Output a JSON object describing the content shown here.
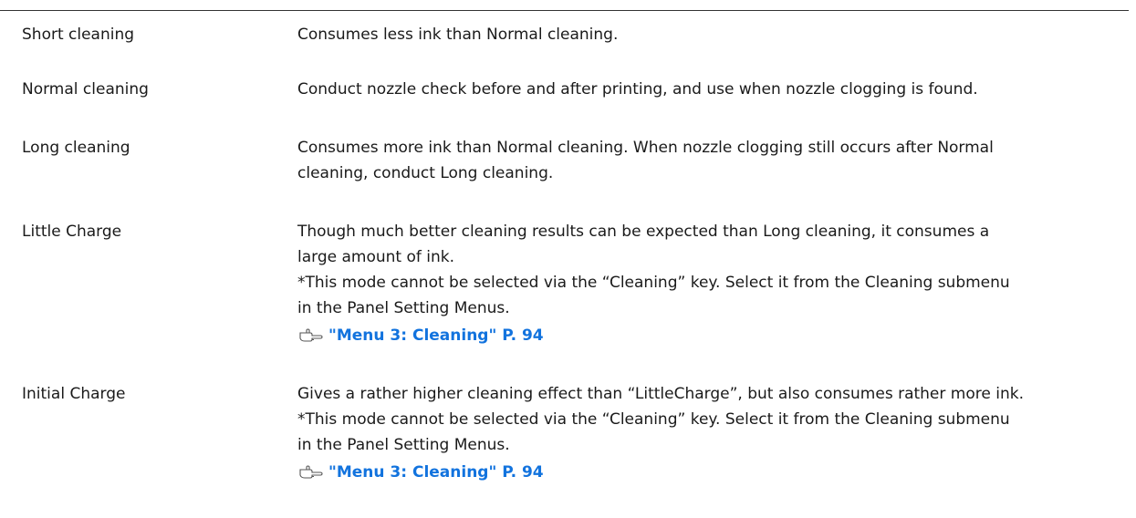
{
  "rows": [
    {
      "term": "Short cleaning",
      "lines": [
        "Consumes less ink than Normal cleaning."
      ]
    },
    {
      "term": "Normal cleaning",
      "lines": [
        "Conduct nozzle check before and after printing, and use when nozzle clogging is found."
      ]
    },
    {
      "term": "Long cleaning",
      "lines": [
        "Consumes more ink than Normal cleaning. When nozzle clogging still occurs after Normal",
        "cleaning, conduct Long cleaning."
      ]
    },
    {
      "term": "Little Charge",
      "lines": [
        "Though much better cleaning results can be expected than Long cleaning, it consumes a",
        "large amount of ink.",
        "*This mode cannot be selected via the “Cleaning” key. Select it from the Cleaning submenu",
        "in the Panel Setting Menus."
      ],
      "xref": "\"Menu 3: Cleaning\" P. 94",
      "xref_icon": "pointing-hand-icon"
    },
    {
      "term": "Initial Charge",
      "lines": [
        "Gives a rather higher cleaning effect than “LittleCharge”, but also consumes rather more ink.",
        "*This mode cannot be selected via the “Cleaning” key. Select it from the Cleaning submenu",
        "in the Panel Setting Menus."
      ],
      "xref": "\"Menu 3: Cleaning\" P. 94",
      "xref_icon": "pointing-hand-icon"
    }
  ],
  "colors": {
    "link": "#1273de",
    "text": "#1a1a1a",
    "rule": "#333333"
  }
}
